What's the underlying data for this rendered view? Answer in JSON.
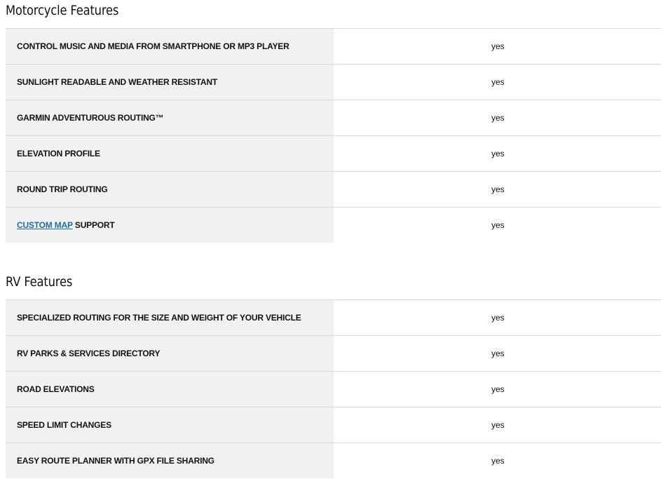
{
  "motorcycle": {
    "title": "Motorcycle Features",
    "rows": [
      {
        "label": "CONTROL MUSIC AND MEDIA FROM SMARTPHONE OR MP3 PLAYER",
        "value": "yes"
      },
      {
        "label": "SUNLIGHT READABLE AND WEATHER RESISTANT",
        "value": "yes"
      },
      {
        "label": "GARMIN ADVENTUROUS ROUTING™",
        "value": "yes"
      },
      {
        "label": "ELEVATION PROFILE",
        "value": "yes"
      },
      {
        "label": "ROUND TRIP ROUTING",
        "value": "yes"
      },
      {
        "label_link": "CUSTOM MAP",
        "label_rest": " SUPPORT",
        "value": "yes"
      }
    ]
  },
  "rv": {
    "title": "RV Features",
    "rows": [
      {
        "label": "SPECIALIZED ROUTING FOR THE SIZE AND WEIGHT OF YOUR VEHICLE",
        "value": "yes"
      },
      {
        "label": "RV PARKS & SERVICES DIRECTORY",
        "value": "yes"
      },
      {
        "label": "ROAD ELEVATIONS",
        "value": "yes"
      },
      {
        "label": "SPEED LIMIT CHANGES",
        "value": "yes"
      },
      {
        "label": "EASY ROUTE PLANNER WITH GPX FILE SHARING",
        "value": "yes"
      }
    ]
  },
  "colors": {
    "label_background": "#f1f1f1",
    "divider": "#d9d9d9",
    "link": "#1f6da6"
  }
}
